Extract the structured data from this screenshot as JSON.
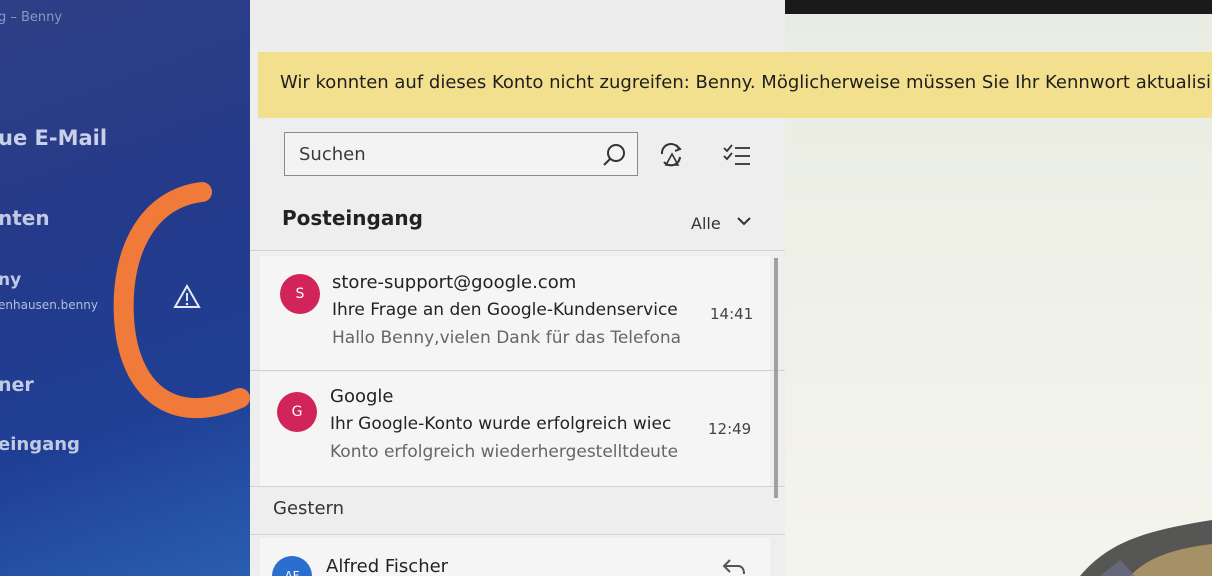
{
  "nav": {
    "title": "g – Benny",
    "new_mail": "ue E-Mail",
    "accounts": "nten",
    "account_name": "ny",
    "account_email": "enhausen.benny",
    "folders": "ner",
    "inbox": "eingang"
  },
  "warning": {
    "message": "Wir konnten auf dieses Konto nicht zugreifen: Benny. Möglicherweise müssen Sie Ihr Kennwort aktualisieren"
  },
  "search": {
    "placeholder": "Suchen"
  },
  "list": {
    "title": "Posteingang",
    "filter": "Alle",
    "group_yesterday": "Gestern"
  },
  "messages": [
    {
      "initial": "S",
      "sender": "store-support@google.com",
      "subject": "Ihre Frage an den Google-Kundenservice",
      "preview": "Hallo Benny,vielen Dank für das Telefona",
      "time": "14:41"
    },
    {
      "initial": "G",
      "sender": "Google",
      "subject": "Ihr Google-Konto wurde erfolgreich wiec",
      "preview": "Konto erfolgreich wiederhergestelltdeute",
      "time": "12:49"
    },
    {
      "initial": "AF",
      "sender": "Alfred Fischer"
    }
  ],
  "colors": {
    "nav_bg": "#243a8a",
    "warning_bg": "#f2e08e",
    "avatar": "#d0245a",
    "avatar_af": "#2a6fd0",
    "annotation": "#f07a3a"
  },
  "icons": [
    "search-icon",
    "sync-icon",
    "select-mode-icon",
    "chevron-down-icon",
    "warning-icon",
    "reply-icon"
  ]
}
